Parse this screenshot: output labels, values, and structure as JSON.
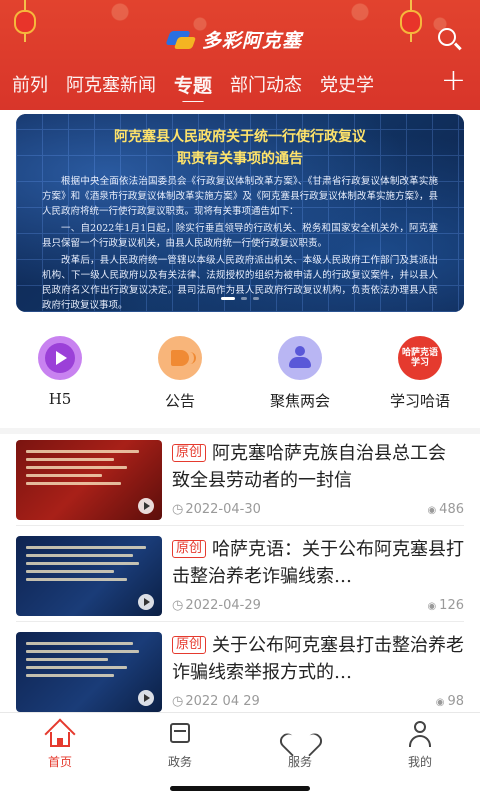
{
  "header": {
    "logo_text": "多彩阿克塞",
    "tabs": [
      {
        "label": "前列",
        "active": false
      },
      {
        "label": "阿克塞新闻",
        "active": false
      },
      {
        "label": "专题",
        "active": true
      },
      {
        "label": "部门动态",
        "active": false
      },
      {
        "label": "党史学",
        "active": false
      }
    ],
    "add_label": "+"
  },
  "banner": {
    "title_line1": "阿克塞县人民政府关于统一行使行政复议",
    "title_line2": "职责有关事项的通告",
    "paragraphs": [
      "根据中央全面依法治国委员会《行政复议体制改革方案》、《甘肃省行政复议体制改革实施方案》和《酒泉市行政复议体制改革实施方案》及《阿克塞县行政复议体制改革实施方案》，县人民政府将统一行使行政复议职责。现将有关事项通告如下：",
      "一、自2022年1月1日起，除实行垂直领导的行政机关、税务和国家安全机关外，阿克塞县只保留一个行政复议机关，由县人民政府统一行使行政复议职责。",
      "改革后，县人民政府统一管辖以本级人民政府派出机关、本级人民政府工作部门及其派出机构、下一级人民政府以及有关法律、法规授权的组织为被申请人的行政复议案件，并以县人民政府名义作出行政复议决定。县司法局作为县人民政府行政复议机构，负责依法办理县人民政府行政复议事项。"
    ],
    "slides": 3,
    "active_slide": 0
  },
  "quick_menu": [
    {
      "label": "H5",
      "icon": "play-icon",
      "color": "#c882f0"
    },
    {
      "label": "公告",
      "icon": "megaphone-icon",
      "color": "#f8b57a"
    },
    {
      "label": "聚焦两会",
      "icon": "meeting-person-icon",
      "color": "#b9b6f3"
    },
    {
      "label": "学习哈语",
      "icon": "study-badge-icon",
      "color": "#e53a2e",
      "badge_text": "哈萨克语学习"
    }
  ],
  "news": [
    {
      "tag": "原创",
      "title": "阿克塞哈萨克族自治县总工会 致全县劳动者的一封信",
      "date": "2022-04-30",
      "views": "486"
    },
    {
      "tag": "原创",
      "title": "哈萨克语：关于公布阿克塞县打击整治养老诈骗线索…",
      "date": "2022-04-29",
      "views": "126"
    },
    {
      "tag": "原创",
      "title": "关于公布阿克塞县打击整治养老诈骗线索举报方式的…",
      "date": "2022 04 29",
      "views": "98"
    }
  ],
  "bottom_nav": [
    {
      "label": "首页",
      "active": true
    },
    {
      "label": "政务",
      "active": false
    },
    {
      "label": "服务",
      "active": false
    },
    {
      "label": "我的",
      "active": false
    }
  ],
  "colors": {
    "brand_red": "#e53a2e",
    "banner_title": "#ffe36a"
  }
}
